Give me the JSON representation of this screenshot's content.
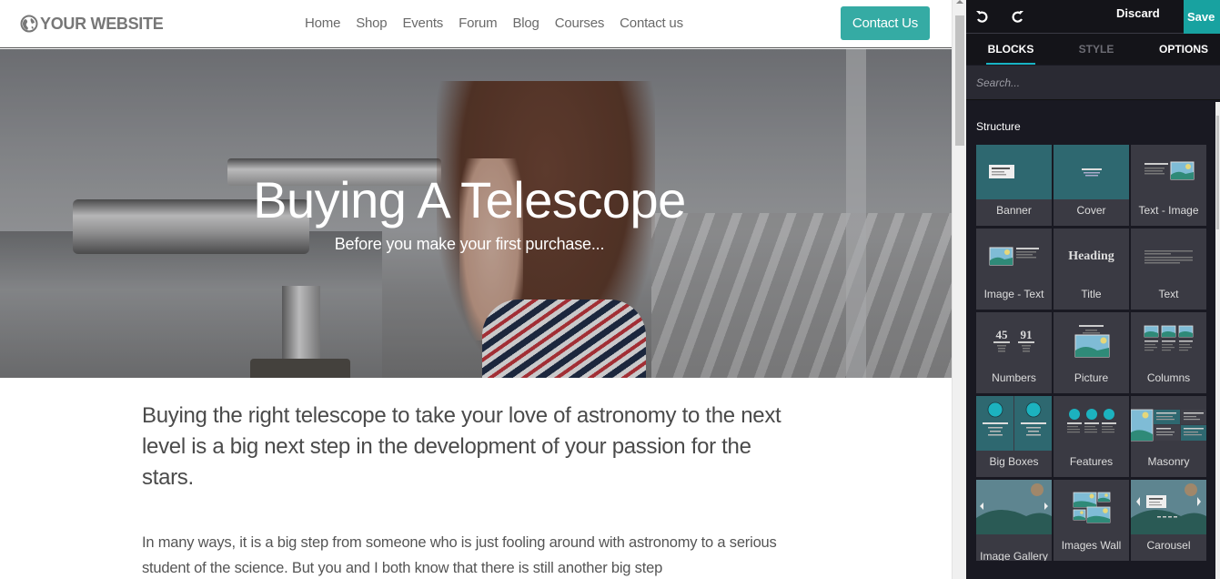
{
  "site": {
    "logo_text": "YOUR WEBSITE",
    "nav": [
      "Home",
      "Shop",
      "Events",
      "Forum",
      "Blog",
      "Courses",
      "Contact us"
    ],
    "cta_label": "Contact Us",
    "hero": {
      "title": "Buying A Telescope",
      "subtitle": "Before you make your first purchase..."
    },
    "lead": "Buying the right telescope to take your love of astronomy to the next level is a big next step in the development of your passion for the stars.",
    "body": "In many ways, it is a big step from someone who is just fooling around with astronomy to a serious student of the science. But you and I both know that there is still another big step"
  },
  "editor": {
    "discard_label": "Discard",
    "save_label": "Save",
    "tabs": [
      "BLOCKS",
      "STYLE",
      "OPTIONS"
    ],
    "active_tab": "BLOCKS",
    "search_placeholder": "Search...",
    "section_title": "Structure",
    "blocks": [
      {
        "label": "Banner",
        "icon": "banner-icon"
      },
      {
        "label": "Cover",
        "icon": "cover-icon"
      },
      {
        "label": "Text - Image",
        "icon": "text-image-icon"
      },
      {
        "label": "Image - Text",
        "icon": "image-text-icon"
      },
      {
        "label": "Title",
        "icon": "title-icon",
        "icon_text": "Heading"
      },
      {
        "label": "Text",
        "icon": "text-icon"
      },
      {
        "label": "Numbers",
        "icon": "numbers-icon",
        "icon_text_1": "45",
        "icon_text_2": "91"
      },
      {
        "label": "Picture",
        "icon": "picture-icon"
      },
      {
        "label": "Columns",
        "icon": "columns-icon"
      },
      {
        "label": "Big Boxes",
        "icon": "big-boxes-icon"
      },
      {
        "label": "Features",
        "icon": "features-icon"
      },
      {
        "label": "Masonry",
        "icon": "masonry-icon"
      },
      {
        "label": "Image Gallery",
        "icon": "image-gallery-icon"
      },
      {
        "label": "Images Wall",
        "icon": "images-wall-icon"
      },
      {
        "label": "Carousel",
        "icon": "carousel-icon"
      }
    ]
  },
  "colors": {
    "accent": "#35aba4",
    "save": "#18a2a0",
    "tab_underline": "#18b3c4",
    "panel_bg": "#191922",
    "block_bg": "#3a3a43"
  }
}
